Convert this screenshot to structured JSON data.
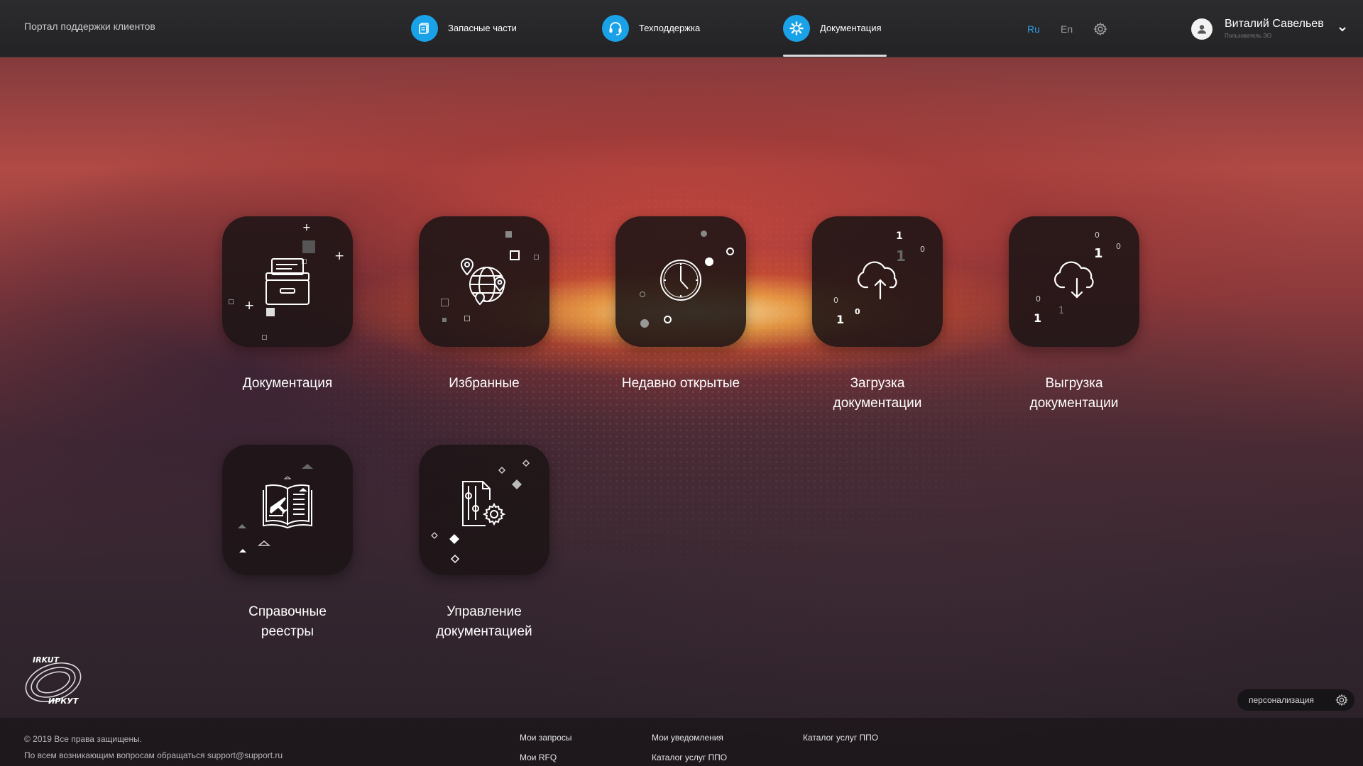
{
  "header": {
    "portal_title": "Портал поддержки клиентов",
    "nav": [
      {
        "label": "Запасные части",
        "icon": "spare-parts-icon",
        "active": false
      },
      {
        "label": "Техподдержка",
        "icon": "headset-icon",
        "active": false
      },
      {
        "label": "Документация",
        "icon": "docs-gear-icon",
        "active": true
      }
    ],
    "languages": [
      {
        "code": "Ru",
        "active": true
      },
      {
        "code": "En",
        "active": false
      }
    ],
    "user": {
      "name": "Виталий Савельев",
      "role": "Пользователь ЭО"
    }
  },
  "tiles": [
    {
      "label_lines": [
        "Документация"
      ],
      "icon": "archive-drawer-icon"
    },
    {
      "label_lines": [
        "Избранные"
      ],
      "icon": "globe-pins-icon"
    },
    {
      "label_lines": [
        "Недавно открытые"
      ],
      "icon": "clock-icon"
    },
    {
      "label_lines": [
        "Загрузка",
        "документации"
      ],
      "icon": "cloud-upload-icon"
    },
    {
      "label_lines": [
        "Выгрузка",
        "документации"
      ],
      "icon": "cloud-download-icon"
    },
    {
      "label_lines": [
        "Справочные",
        "реестры"
      ],
      "icon": "book-plane-icon"
    },
    {
      "label_lines": [
        "Управление",
        "документацией"
      ],
      "icon": "document-settings-icon"
    }
  ],
  "binary_digits": {
    "one": "1",
    "zero": "0"
  },
  "logo": {
    "text_top": "IRKUT",
    "text_bottom": "ИРКУТ"
  },
  "footer": {
    "copyright": "© 2019 Все права защищены.",
    "contact": "По всем возникающим вопросам обращаться support@support.ru",
    "links_col1": [
      "Мои запросы",
      "Мои RFQ"
    ],
    "links_col2": [
      "Мои уведомления",
      "Каталог услуг ППО"
    ],
    "links_col3": [
      "Каталог услуг ППО"
    ]
  },
  "personalization": {
    "label": "персонализация"
  },
  "colors": {
    "accent": "#1aa2e8",
    "active_lang": "#2f9be0",
    "inactive_lang": "#9a9a9a"
  }
}
